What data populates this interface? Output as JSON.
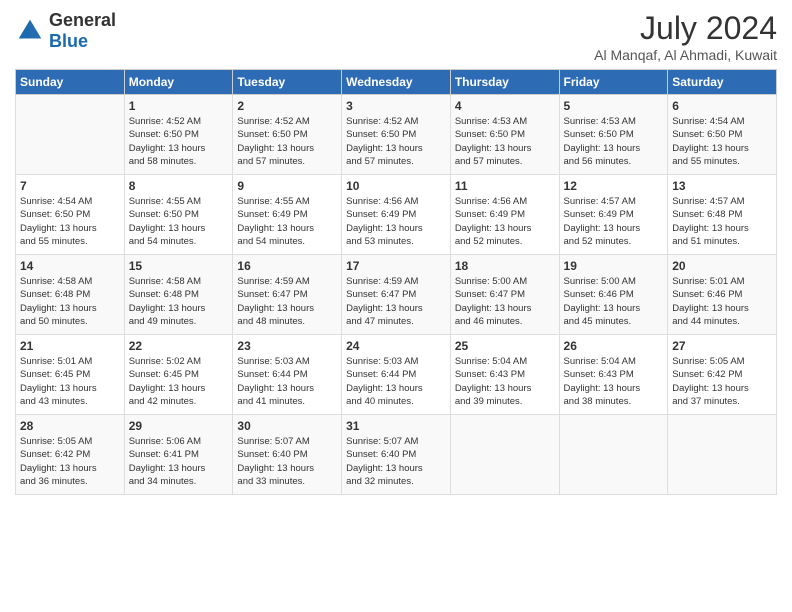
{
  "header": {
    "logo_general": "General",
    "logo_blue": "Blue",
    "month_year": "July 2024",
    "location": "Al Manqaf, Al Ahmadi, Kuwait"
  },
  "days_of_week": [
    "Sunday",
    "Monday",
    "Tuesday",
    "Wednesday",
    "Thursday",
    "Friday",
    "Saturday"
  ],
  "weeks": [
    [
      {
        "day": "",
        "info": ""
      },
      {
        "day": "1",
        "info": "Sunrise: 4:52 AM\nSunset: 6:50 PM\nDaylight: 13 hours\nand 58 minutes."
      },
      {
        "day": "2",
        "info": "Sunrise: 4:52 AM\nSunset: 6:50 PM\nDaylight: 13 hours\nand 57 minutes."
      },
      {
        "day": "3",
        "info": "Sunrise: 4:52 AM\nSunset: 6:50 PM\nDaylight: 13 hours\nand 57 minutes."
      },
      {
        "day": "4",
        "info": "Sunrise: 4:53 AM\nSunset: 6:50 PM\nDaylight: 13 hours\nand 57 minutes."
      },
      {
        "day": "5",
        "info": "Sunrise: 4:53 AM\nSunset: 6:50 PM\nDaylight: 13 hours\nand 56 minutes."
      },
      {
        "day": "6",
        "info": "Sunrise: 4:54 AM\nSunset: 6:50 PM\nDaylight: 13 hours\nand 55 minutes."
      }
    ],
    [
      {
        "day": "7",
        "info": "Sunrise: 4:54 AM\nSunset: 6:50 PM\nDaylight: 13 hours\nand 55 minutes."
      },
      {
        "day": "8",
        "info": "Sunrise: 4:55 AM\nSunset: 6:50 PM\nDaylight: 13 hours\nand 54 minutes."
      },
      {
        "day": "9",
        "info": "Sunrise: 4:55 AM\nSunset: 6:49 PM\nDaylight: 13 hours\nand 54 minutes."
      },
      {
        "day": "10",
        "info": "Sunrise: 4:56 AM\nSunset: 6:49 PM\nDaylight: 13 hours\nand 53 minutes."
      },
      {
        "day": "11",
        "info": "Sunrise: 4:56 AM\nSunset: 6:49 PM\nDaylight: 13 hours\nand 52 minutes."
      },
      {
        "day": "12",
        "info": "Sunrise: 4:57 AM\nSunset: 6:49 PM\nDaylight: 13 hours\nand 52 minutes."
      },
      {
        "day": "13",
        "info": "Sunrise: 4:57 AM\nSunset: 6:48 PM\nDaylight: 13 hours\nand 51 minutes."
      }
    ],
    [
      {
        "day": "14",
        "info": "Sunrise: 4:58 AM\nSunset: 6:48 PM\nDaylight: 13 hours\nand 50 minutes."
      },
      {
        "day": "15",
        "info": "Sunrise: 4:58 AM\nSunset: 6:48 PM\nDaylight: 13 hours\nand 49 minutes."
      },
      {
        "day": "16",
        "info": "Sunrise: 4:59 AM\nSunset: 6:47 PM\nDaylight: 13 hours\nand 48 minutes."
      },
      {
        "day": "17",
        "info": "Sunrise: 4:59 AM\nSunset: 6:47 PM\nDaylight: 13 hours\nand 47 minutes."
      },
      {
        "day": "18",
        "info": "Sunrise: 5:00 AM\nSunset: 6:47 PM\nDaylight: 13 hours\nand 46 minutes."
      },
      {
        "day": "19",
        "info": "Sunrise: 5:00 AM\nSunset: 6:46 PM\nDaylight: 13 hours\nand 45 minutes."
      },
      {
        "day": "20",
        "info": "Sunrise: 5:01 AM\nSunset: 6:46 PM\nDaylight: 13 hours\nand 44 minutes."
      }
    ],
    [
      {
        "day": "21",
        "info": "Sunrise: 5:01 AM\nSunset: 6:45 PM\nDaylight: 13 hours\nand 43 minutes."
      },
      {
        "day": "22",
        "info": "Sunrise: 5:02 AM\nSunset: 6:45 PM\nDaylight: 13 hours\nand 42 minutes."
      },
      {
        "day": "23",
        "info": "Sunrise: 5:03 AM\nSunset: 6:44 PM\nDaylight: 13 hours\nand 41 minutes."
      },
      {
        "day": "24",
        "info": "Sunrise: 5:03 AM\nSunset: 6:44 PM\nDaylight: 13 hours\nand 40 minutes."
      },
      {
        "day": "25",
        "info": "Sunrise: 5:04 AM\nSunset: 6:43 PM\nDaylight: 13 hours\nand 39 minutes."
      },
      {
        "day": "26",
        "info": "Sunrise: 5:04 AM\nSunset: 6:43 PM\nDaylight: 13 hours\nand 38 minutes."
      },
      {
        "day": "27",
        "info": "Sunrise: 5:05 AM\nSunset: 6:42 PM\nDaylight: 13 hours\nand 37 minutes."
      }
    ],
    [
      {
        "day": "28",
        "info": "Sunrise: 5:05 AM\nSunset: 6:42 PM\nDaylight: 13 hours\nand 36 minutes."
      },
      {
        "day": "29",
        "info": "Sunrise: 5:06 AM\nSunset: 6:41 PM\nDaylight: 13 hours\nand 34 minutes."
      },
      {
        "day": "30",
        "info": "Sunrise: 5:07 AM\nSunset: 6:40 PM\nDaylight: 13 hours\nand 33 minutes."
      },
      {
        "day": "31",
        "info": "Sunrise: 5:07 AM\nSunset: 6:40 PM\nDaylight: 13 hours\nand 32 minutes."
      },
      {
        "day": "",
        "info": ""
      },
      {
        "day": "",
        "info": ""
      },
      {
        "day": "",
        "info": ""
      }
    ]
  ]
}
